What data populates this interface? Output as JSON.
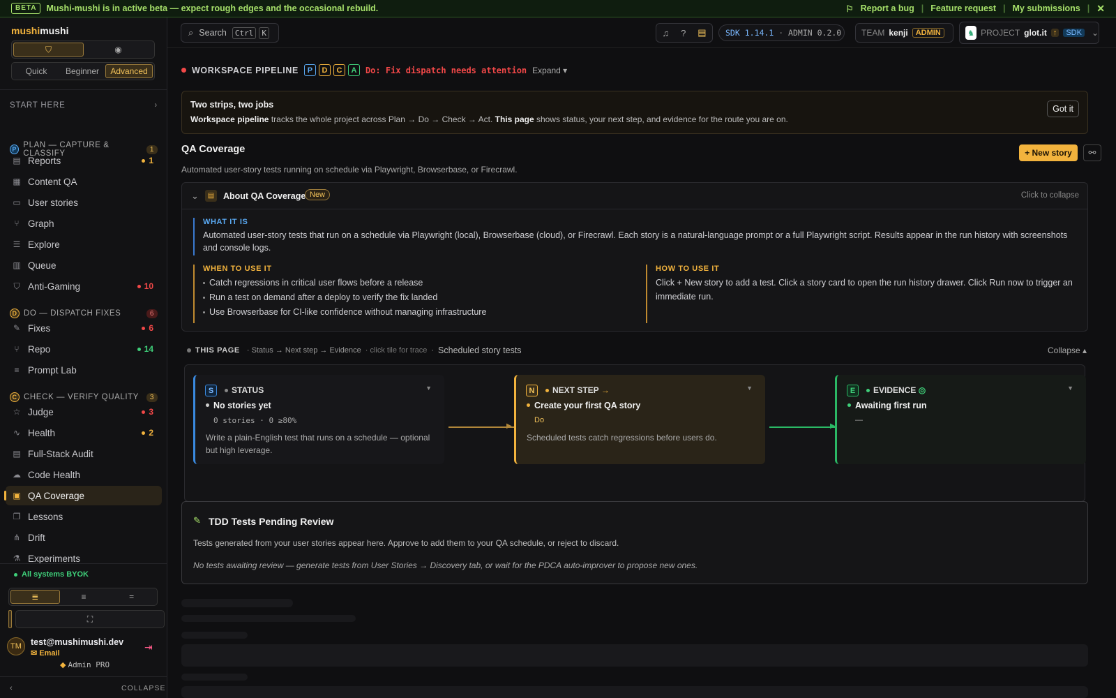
{
  "banner": {
    "beta": "BETA",
    "message": "Mushi-mushi is in active beta — expect rough edges and the occasional rebuild.",
    "report_bug": "Report a bug",
    "feature_request": "Feature request",
    "my_submissions": "My submissions"
  },
  "sidebar": {
    "brand_a": "mushi",
    "brand_b": "mushi",
    "modes": [
      "Quick",
      "Beginner",
      "Advanced"
    ],
    "active_mode": "Advanced",
    "start_here": "START HERE",
    "groups": [
      {
        "letter": "P",
        "title": "PLAN — CAPTURE & CLASSIFY",
        "count": "1",
        "color": "#5aa9f2",
        "items": [
          {
            "label": "Reports",
            "icon": "report-icon",
            "badge": "1",
            "badge_color": "#f2b33d"
          },
          {
            "label": "Content QA",
            "icon": "content-qa-icon"
          },
          {
            "label": "User stories",
            "icon": "user-stories-icon"
          },
          {
            "label": "Graph",
            "icon": "graph-icon"
          },
          {
            "label": "Explore",
            "icon": "explore-icon"
          },
          {
            "label": "Queue",
            "icon": "queue-icon"
          },
          {
            "label": "Anti-Gaming",
            "icon": "shield-icon",
            "badge": "10",
            "badge_color": "#f24848"
          }
        ]
      },
      {
        "letter": "D",
        "title": "DO — DISPATCH FIXES",
        "count": "6",
        "color": "#f2b33d",
        "items": [
          {
            "label": "Fixes",
            "icon": "wrench-icon",
            "badge": "6",
            "badge_color": "#f24848"
          },
          {
            "label": "Repo",
            "icon": "branch-icon",
            "badge": "14",
            "badge_color": "#3fd07a"
          },
          {
            "label": "Prompt Lab",
            "icon": "prompt-icon"
          }
        ]
      },
      {
        "letter": "C",
        "title": "CHECK — VERIFY QUALITY",
        "count": "3",
        "color": "#f2b33d",
        "items": [
          {
            "label": "Judge",
            "icon": "star-icon",
            "badge": "3",
            "badge_color": "#f24848"
          },
          {
            "label": "Health",
            "icon": "pulse-icon",
            "badge": "2",
            "badge_color": "#f2b33d"
          },
          {
            "label": "Full-Stack Audit",
            "icon": "audit-icon"
          },
          {
            "label": "Code Health",
            "icon": "code-health-icon"
          },
          {
            "label": "QA Coverage",
            "icon": "qa-coverage-icon",
            "active": true
          },
          {
            "label": "Lessons",
            "icon": "book-icon"
          },
          {
            "label": "Drift",
            "icon": "drift-icon"
          },
          {
            "label": "Experiments",
            "icon": "flask-icon"
          }
        ]
      }
    ],
    "status": "All systems BYOK",
    "user": {
      "initials": "TM",
      "email": "test@mushimushi.dev",
      "method": "Email",
      "plan": "Admin PRO"
    },
    "collapse": "COLLAPSE"
  },
  "topbar": {
    "search": "Search",
    "kbd1": "Ctrl",
    "kbd2": "K",
    "sdk_label": "SDK",
    "sdk_version": "1.14.1",
    "admin_label": "ADMIN",
    "admin_version": "0.2.0",
    "team_label": "TEAM",
    "team_name": "kenji",
    "team_role": "ADMIN",
    "project_label": "PROJECT",
    "project_name": "glot.it",
    "project_tag": "SDK"
  },
  "pipeline": {
    "title": "WORKSPACE PIPELINE",
    "stages": [
      "P",
      "D",
      "C",
      "A"
    ],
    "alert": "Do: Fix dispatch needs attention",
    "expand": "Expand"
  },
  "intro": {
    "title": "Two strips, two jobs",
    "b1": "Workspace pipeline",
    "t1": " tracks the whole project across Plan → Do → Check → Act. ",
    "b2": "This page",
    "t2": " shows status, your next step, and evidence for the route you are on.",
    "button": "Got it"
  },
  "page": {
    "title": "QA Coverage",
    "subtitle": "Automated user-story tests running on schedule via Playwright, Browserbase, or Firecrawl.",
    "new_story": "+ New story"
  },
  "about": {
    "title": "About QA Coverage",
    "badge": "New",
    "collapse": "Click to collapse",
    "what_h": "WHAT IT IS",
    "what": "Automated user-story tests that run on a schedule via Playwright (local), Browserbase (cloud), or Firecrawl. Each story is a natural-language prompt or a full Playwright script. Results appear in the run history with screenshots and console logs.",
    "when_h": "WHEN TO USE IT",
    "when": [
      "Catch regressions in critical user flows before a release",
      "Run a test on demand after a deploy to verify the fix landed",
      "Use Browserbase for CI-like confidence without managing infrastructure"
    ],
    "how_h": "HOW TO USE IT",
    "how": "Click + New story to add a test. Click a story card to open the run history drawer. Click Run now to trigger an immediate run."
  },
  "this_page": {
    "title": "THIS PAGE",
    "flow": "· Status → Next step → Evidence",
    "hint": "· click tile for trace",
    "sep": "·",
    "context": "Scheduled story tests",
    "collapse": "Collapse",
    "status": {
      "letter": "S",
      "label": "STATUS",
      "headline": "No stories yet",
      "meta": "0 stories · 0 ≥80%",
      "desc": "Write a plain-English test that runs on a schedule — optional but high leverage."
    },
    "next": {
      "letter": "N",
      "label": "NEXT STEP",
      "arrow": "→",
      "headline": "Create your first QA story",
      "tag": "Do",
      "desc": "Scheduled tests catch regressions before users do."
    },
    "evidence": {
      "letter": "E",
      "label": "EVIDENCE",
      "headline": "Awaiting first run",
      "meta": "—"
    }
  },
  "tdd": {
    "title": "TDD Tests Pending Review",
    "desc": "Tests generated from your user stories appear here. Approve to add them to your QA schedule, or reject to discard.",
    "empty": "No tests awaiting review — generate tests from User Stories → Discovery tab, or wait for the PDCA auto-improver to propose new ones."
  }
}
